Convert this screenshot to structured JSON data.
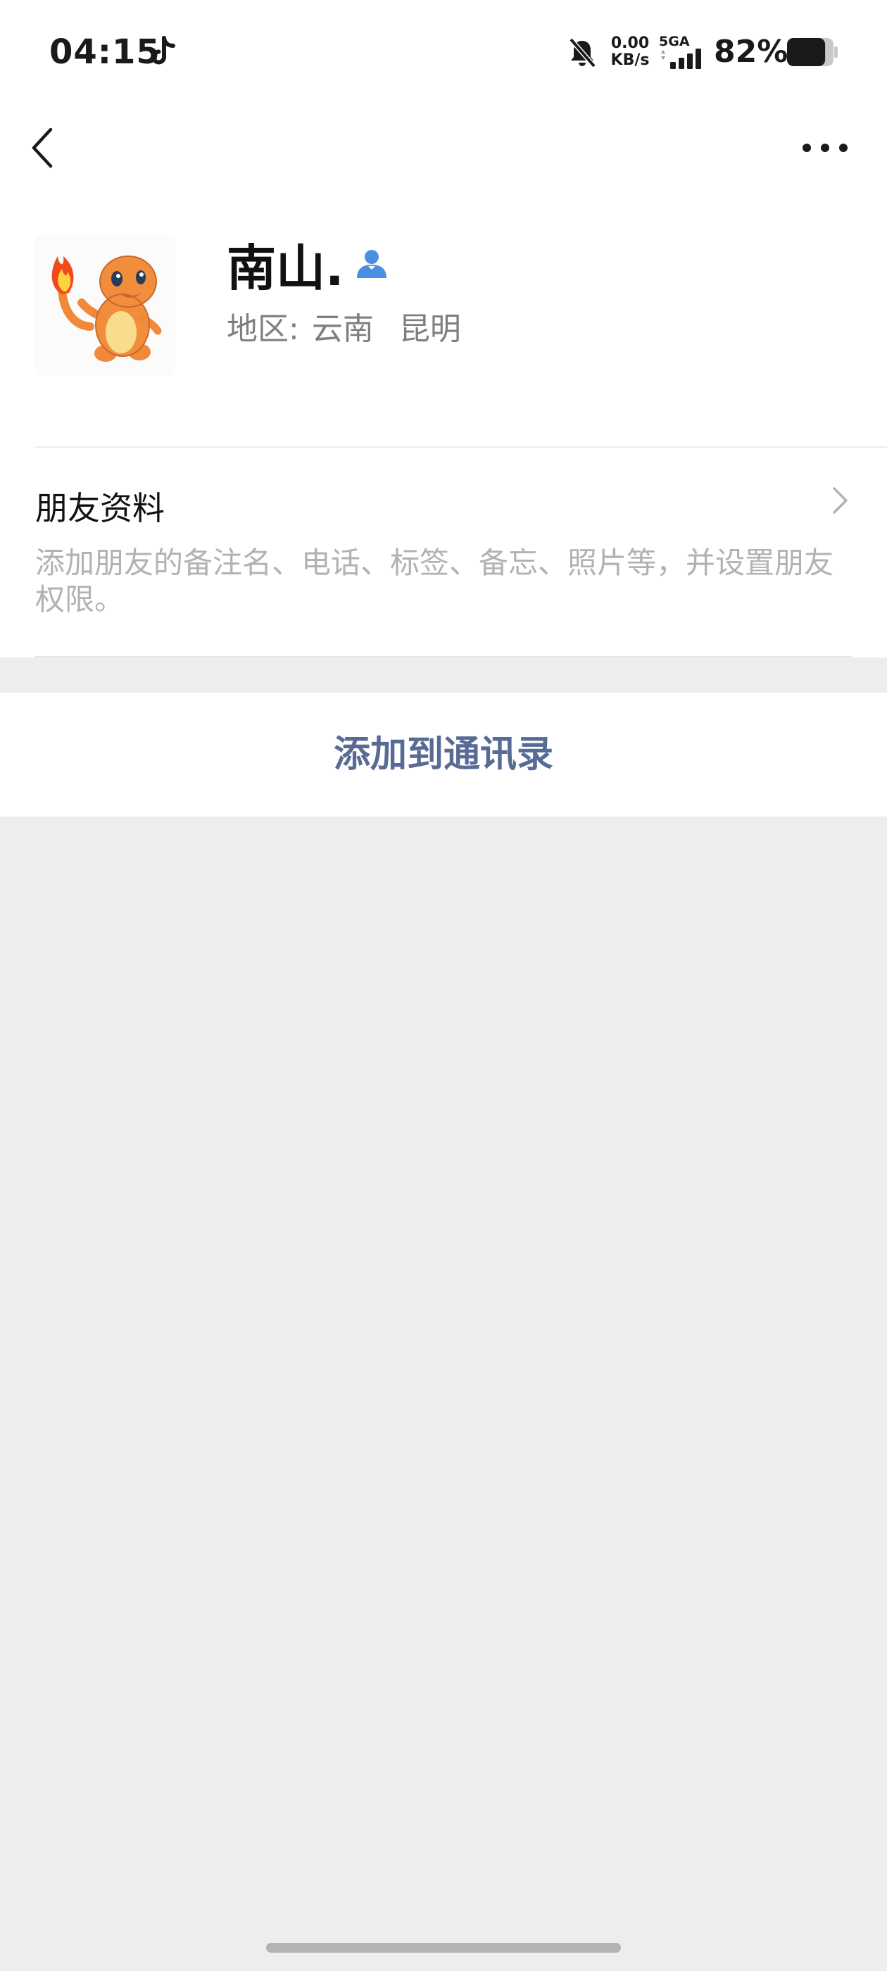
{
  "status_bar": {
    "time": "04:15",
    "net_speed_value": "0.00",
    "net_speed_unit": "KB/s",
    "network_type": "5GA",
    "battery_percent": "82%",
    "battery_level": 0.82,
    "icons": [
      "tiktok-icon",
      "bell-off-icon",
      "signal-icon",
      "battery-icon"
    ]
  },
  "nav": {
    "back_icon": "chevron-left-icon",
    "more_icon": "more-dots-icon"
  },
  "profile": {
    "nickname": "南山.",
    "region_label": "地区:",
    "region_province": "云南",
    "region_city": "昆明",
    "badge_icon": "contact-person-icon",
    "badge_color": "#4a90e2"
  },
  "friend_info": {
    "title": "朋友资料",
    "description": "添加朋友的备注名、电话、标签、备忘、照片等，并设置朋友权限。"
  },
  "actions": {
    "add_to_contacts": "添加到通讯录"
  },
  "colors": {
    "link_blue": "#576b95",
    "page_background": "#ededed",
    "secondary_text": "#7f7f7f",
    "hint_text": "#b2b2b2"
  }
}
